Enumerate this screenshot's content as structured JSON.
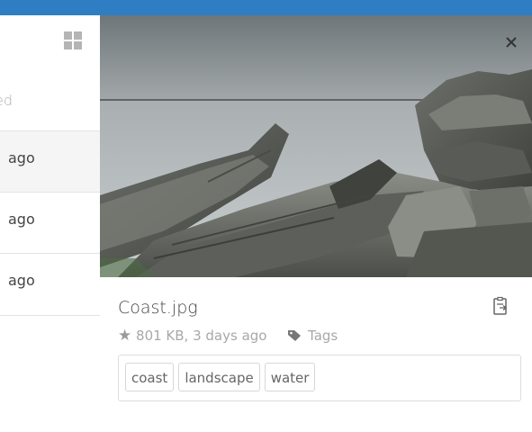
{
  "colors": {
    "topbar": "#2f7ec4",
    "selected_row": "#f5f5f5"
  },
  "list": {
    "view_icon": "grid-icon",
    "sort_label_fragment": "ed",
    "rows": [
      {
        "text": "ago"
      },
      {
        "text": "ago"
      },
      {
        "text": "ago"
      }
    ]
  },
  "detail": {
    "close_icon": "close-icon",
    "file_name": "Coast.jpg",
    "copy_icon": "clipboard-icon",
    "star_icon": "star-icon",
    "meta_text": "801 KB, 3 days ago",
    "tag_icon": "tag-icon",
    "tags_label": "Tags",
    "tags": [
      "coast",
      "landscape",
      "water"
    ]
  }
}
